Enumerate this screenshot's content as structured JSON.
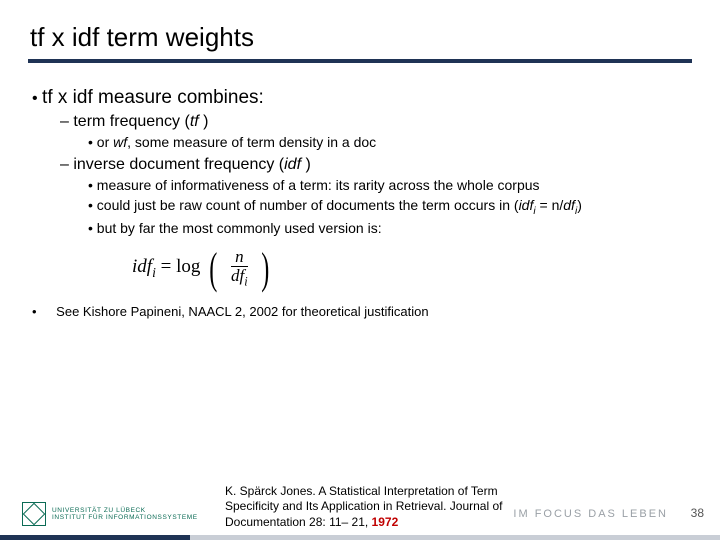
{
  "title": "tf x idf term weights",
  "b1": "tf x idf measure combines:",
  "b1a_pre": "term frequency (",
  "b1a_it": "tf ",
  "b1a_post": ")",
  "b1a1_pre": "or ",
  "b1a1_it": "wf",
  "b1a1_post": ", some measure of term density in a doc",
  "b1b_pre": "inverse document frequency (",
  "b1b_it": "idf ",
  "b1b_post": ")",
  "b1b1": "measure of informativeness of a term: its rarity across the whole corpus",
  "b1b2_pre": "could just be raw count of number of documents the term occurs in (",
  "b1b2_it1": "idf",
  "b1b2_sub1": "i",
  "b1b2_eq": " = n/",
  "b1b2_it2": "df",
  "b1b2_sub2": "i",
  "b1b2_post": ")",
  "b1b3": "but by far the most commonly used version is:",
  "formula": {
    "lhs_var": "idf",
    "lhs_sub": "i",
    "eq": " = log",
    "num": "n",
    "den_var": "df",
    "den_sub": "i"
  },
  "note": "See Kishore Papineni, NAACL 2, 2002 for theoretical justification",
  "citation_main": "K. Spärck Jones. A Statistical Interpretation of Term Specificity and Its Application in Retrieval. Journal of Documentation 28: 11– 21, ",
  "citation_year": "1972",
  "footer_logo_l1": "UNIVERSITÄT ZU LÜBECK",
  "footer_logo_l2": "INSTITUT FÜR INFORMATIONSSYSTEME",
  "footer_right": "IM FOCUS DAS LEBEN",
  "slide_number": "38"
}
